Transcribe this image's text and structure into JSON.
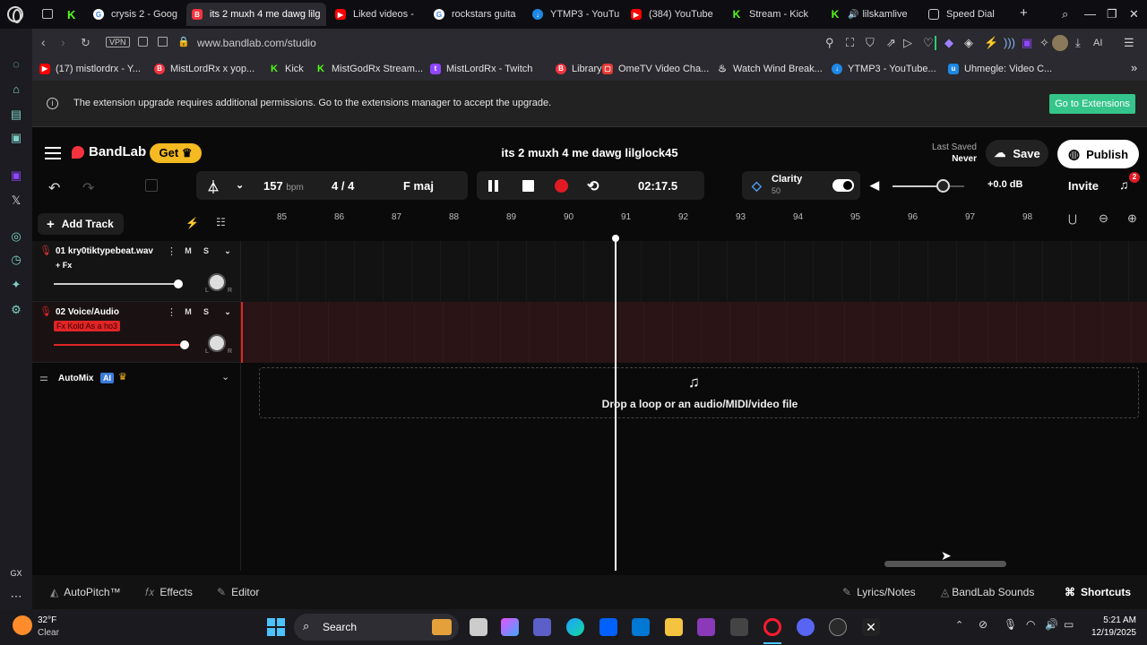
{
  "browser": {
    "tabs": [
      {
        "label": "crysis 2 - Goog",
        "icon": "google-icon",
        "active": false
      },
      {
        "label": "its 2 muxh 4 me dawg lilg",
        "icon": "bandlab-icon",
        "active": true
      },
      {
        "label": "Liked videos -",
        "icon": "youtube-icon",
        "active": false
      },
      {
        "label": "rockstars guita",
        "icon": "google-icon",
        "active": false
      },
      {
        "label": "YTMP3 - YouTu",
        "icon": "ytmp3-icon",
        "active": false
      },
      {
        "label": "(384) YouTube",
        "icon": "youtube-icon",
        "active": false
      },
      {
        "label": "Stream - Kick",
        "icon": "kick-icon",
        "active": false
      },
      {
        "label": "lilskamlive",
        "icon": "kick-icon",
        "active": false
      },
      {
        "label": "Speed Dial",
        "icon": "speed-dial-icon",
        "active": false
      }
    ],
    "vpn_label": "VPN",
    "url": "www.bandlab.com/studio",
    "ai_label": "AI",
    "bookmarks": [
      "(17) mistlordrx - Y...",
      "MistLordRx x yop...",
      "Kick",
      "MistGodRx Stream...",
      "MistLordRx - Twitch",
      "Library",
      "OmeTV Video Cha...",
      "Watch Wind Break...",
      "YTMP3 - YouTube...",
      "Uhmegle: Video C..."
    ],
    "banner": {
      "message": "The extension upgrade requires additional permissions. Go to the extensions manager to accept the upgrade.",
      "button": "Go to Extensions"
    }
  },
  "studio": {
    "brand": "BandLab",
    "get_label": "Get",
    "project_title": "its 2 muxh 4 me dawg lilglock45",
    "last_saved_label": "Last Saved",
    "last_saved_value": "Never",
    "save_label": "Save",
    "publish_label": "Publish",
    "bpm": "157",
    "bpm_unit": "bpm",
    "time_sig_top": "4",
    "time_sig_sep": "/",
    "time_sig_bottom": "4",
    "key": "F maj",
    "time": "02:17.5",
    "clarity_label": "Clarity",
    "clarity_value": "50",
    "db": "+0.0 dB",
    "invite_label": "Invite",
    "notif_count": "2",
    "volume_level": 0.7,
    "add_track_label": "Add Track",
    "ruler": [
      "85",
      "86",
      "87",
      "88",
      "89",
      "90",
      "91",
      "92",
      "93",
      "94",
      "95",
      "96",
      "97",
      "98"
    ],
    "tracks": [
      {
        "name": "01  kry0tiktypebeat.wav",
        "fx": "+ Fx",
        "m": "M",
        "s": "S",
        "color": "#cc3333",
        "volume": 0.82
      },
      {
        "name": "02  Voice/Audio",
        "fx": "Fx  Kold As a ho3",
        "m": "M",
        "s": "S",
        "color": "#e02525",
        "volume": 0.86
      }
    ],
    "automix_label": "AutoMix",
    "ai_badge": "AI",
    "drop_text": "Drop a loop or an audio/MIDI/video file",
    "bottom": {
      "autopitch": "AutoPitch™",
      "effects": "Effects",
      "editor": "Editor",
      "lyrics": "Lyrics/Notes",
      "sounds": "BandLab Sounds",
      "shortcuts": "Shortcuts"
    },
    "accent": "#f5333f"
  },
  "taskbar": {
    "weather_temp": "32°F",
    "weather_desc": "Clear",
    "search_label": "Search",
    "time": "5:21 AM",
    "date": "12/19/2025"
  }
}
